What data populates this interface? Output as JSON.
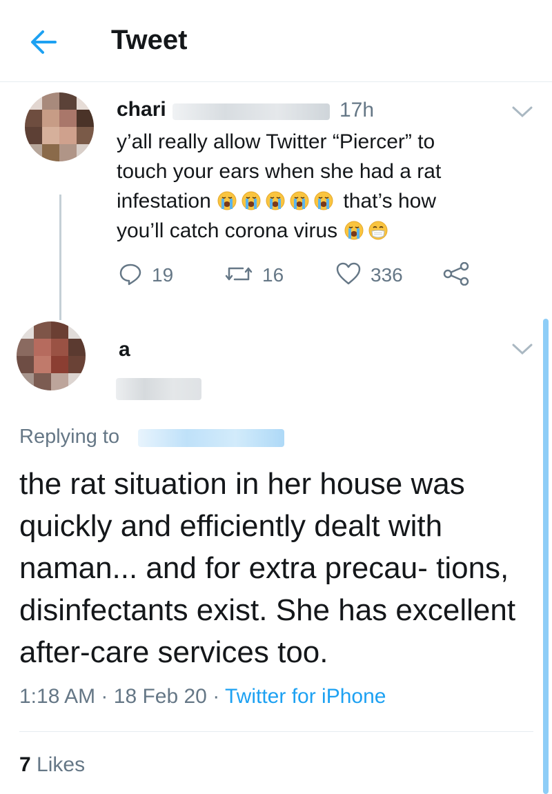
{
  "header": {
    "title": "Tweet"
  },
  "original_tweet": {
    "author_name": "chari",
    "time_ago": "17h",
    "text_lines": [
      "y’all really allow Twitter “Piercer” to",
      "touch your ears when she had a rat",
      "infestation",
      "that’s how",
      "you’ll catch corona virus"
    ],
    "emoji_names": [
      "loudly-crying-face",
      "face-with-medical-mask"
    ],
    "replies": "19",
    "retweets": "16",
    "likes": "336"
  },
  "reply_tweet": {
    "author_name": "a",
    "replying_label": "Replying to",
    "text": "the rat situation in her house was quickly and efficiently dealt with naman... and for extra precau- tions, disinfectants exist. She has excellent after-care services too.",
    "timestamp": "1:18 AM",
    "separator": "·",
    "date": "18 Feb 20",
    "source": "Twitter for iPhone",
    "likes_count": "7",
    "likes_label": "Likes"
  },
  "colors": {
    "accent": "#1da1f2",
    "muted": "#657786",
    "text": "#14171a",
    "divider": "#e6ecf0"
  }
}
